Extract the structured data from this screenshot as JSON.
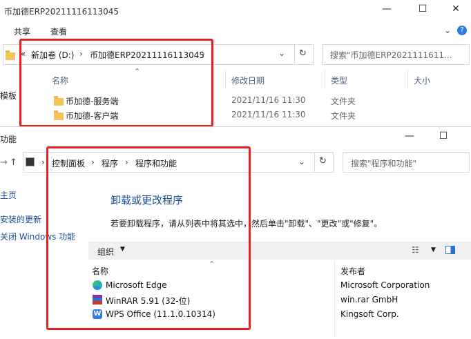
{
  "explorer": {
    "title": "币加德ERP20211116113045",
    "ribbon": {
      "share": "共享",
      "view": "查看"
    },
    "address": {
      "chev_left": "«",
      "drive": "新加卷 (D:)",
      "folder": "币加德ERP20211116113045"
    },
    "search_placeholder": "搜索\"币加德ERP2021111611...",
    "columns": {
      "name": "名称",
      "date": "修改日期",
      "type": "类型",
      "size": "大小"
    },
    "left_fragment": "模板",
    "rows": [
      {
        "name": "币加德-服务端",
        "date": "2021/11/16 11:30",
        "type": "文件夹"
      },
      {
        "name": "币加德-客户端",
        "date": "2021/11/16 11:30",
        "type": "文件夹"
      }
    ]
  },
  "programs": {
    "title_fragment": "功能",
    "address": {
      "cp": "控制面板",
      "prog": "程序",
      "pf": "程序和功能"
    },
    "search_placeholder": "搜索\"程序和功能\"",
    "left_links": [
      "主页",
      "安装的更新",
      "关闭 Windows 功能"
    ],
    "heading": "卸载或更改程序",
    "description": "若要卸载程序，请从列表中将其选中，然后单击\"卸载\"、\"更改\"或\"修复\"。",
    "organize": "组织",
    "columns": {
      "name": "名称",
      "publisher": "发布者"
    },
    "list": [
      {
        "name": "Microsoft Edge",
        "publisher": "Microsoft Corporation",
        "icon": "edge-icon"
      },
      {
        "name": "WinRAR 5.91 (32-位)",
        "publisher": "win.rar GmbH",
        "icon": "winrar-icon"
      },
      {
        "name": "WPS Office (11.1.0.10314)",
        "publisher": "Kingsoft Corp.",
        "icon": "wps-icon"
      }
    ]
  },
  "colors": {
    "highlight_box": "#e8201f",
    "link": "#1a4e96"
  }
}
